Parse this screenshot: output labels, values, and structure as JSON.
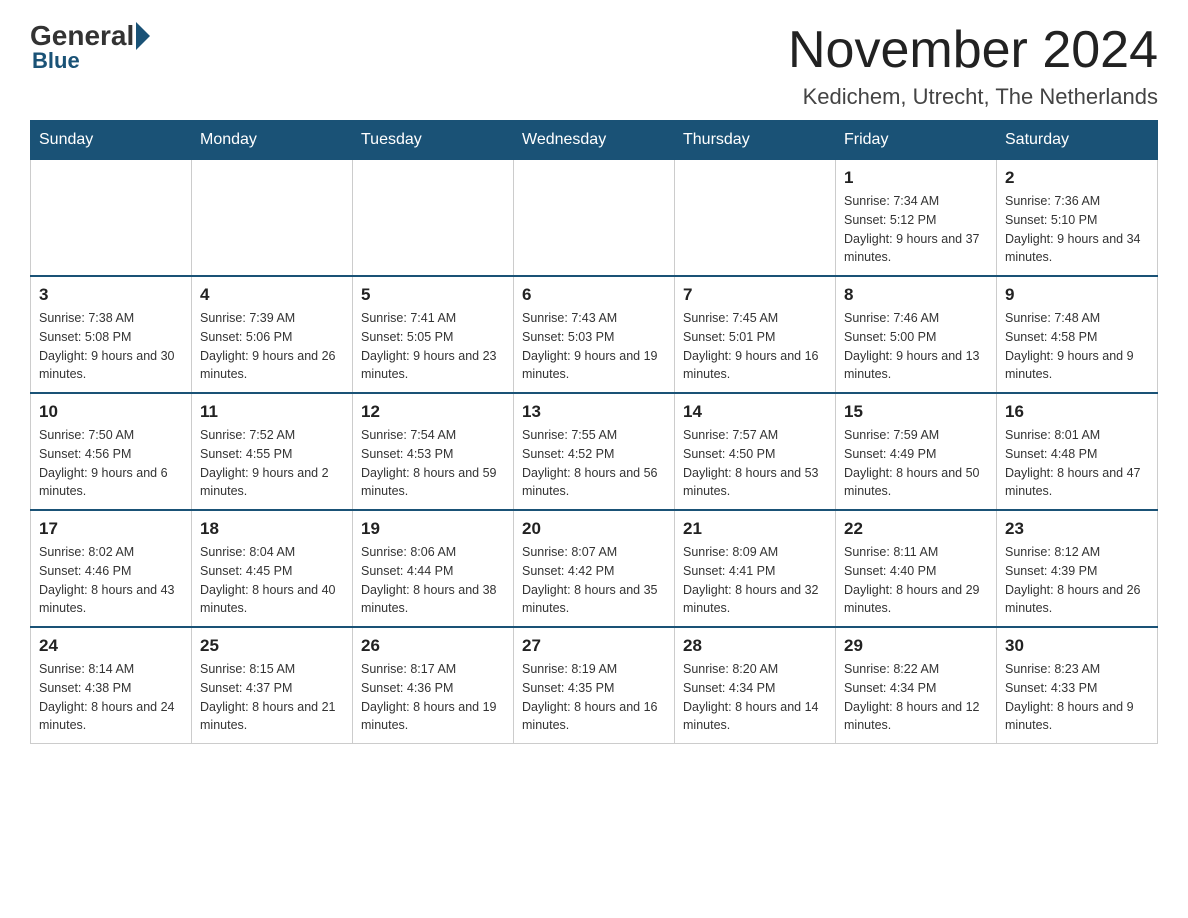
{
  "logo": {
    "general": "General",
    "blue": "Blue"
  },
  "title": "November 2024",
  "location": "Kedichem, Utrecht, The Netherlands",
  "days_of_week": [
    "Sunday",
    "Monday",
    "Tuesday",
    "Wednesday",
    "Thursday",
    "Friday",
    "Saturday"
  ],
  "weeks": [
    [
      {
        "day": "",
        "info": ""
      },
      {
        "day": "",
        "info": ""
      },
      {
        "day": "",
        "info": ""
      },
      {
        "day": "",
        "info": ""
      },
      {
        "day": "",
        "info": ""
      },
      {
        "day": "1",
        "info": "Sunrise: 7:34 AM\nSunset: 5:12 PM\nDaylight: 9 hours and 37 minutes."
      },
      {
        "day": "2",
        "info": "Sunrise: 7:36 AM\nSunset: 5:10 PM\nDaylight: 9 hours and 34 minutes."
      }
    ],
    [
      {
        "day": "3",
        "info": "Sunrise: 7:38 AM\nSunset: 5:08 PM\nDaylight: 9 hours and 30 minutes."
      },
      {
        "day": "4",
        "info": "Sunrise: 7:39 AM\nSunset: 5:06 PM\nDaylight: 9 hours and 26 minutes."
      },
      {
        "day": "5",
        "info": "Sunrise: 7:41 AM\nSunset: 5:05 PM\nDaylight: 9 hours and 23 minutes."
      },
      {
        "day": "6",
        "info": "Sunrise: 7:43 AM\nSunset: 5:03 PM\nDaylight: 9 hours and 19 minutes."
      },
      {
        "day": "7",
        "info": "Sunrise: 7:45 AM\nSunset: 5:01 PM\nDaylight: 9 hours and 16 minutes."
      },
      {
        "day": "8",
        "info": "Sunrise: 7:46 AM\nSunset: 5:00 PM\nDaylight: 9 hours and 13 minutes."
      },
      {
        "day": "9",
        "info": "Sunrise: 7:48 AM\nSunset: 4:58 PM\nDaylight: 9 hours and 9 minutes."
      }
    ],
    [
      {
        "day": "10",
        "info": "Sunrise: 7:50 AM\nSunset: 4:56 PM\nDaylight: 9 hours and 6 minutes."
      },
      {
        "day": "11",
        "info": "Sunrise: 7:52 AM\nSunset: 4:55 PM\nDaylight: 9 hours and 2 minutes."
      },
      {
        "day": "12",
        "info": "Sunrise: 7:54 AM\nSunset: 4:53 PM\nDaylight: 8 hours and 59 minutes."
      },
      {
        "day": "13",
        "info": "Sunrise: 7:55 AM\nSunset: 4:52 PM\nDaylight: 8 hours and 56 minutes."
      },
      {
        "day": "14",
        "info": "Sunrise: 7:57 AM\nSunset: 4:50 PM\nDaylight: 8 hours and 53 minutes."
      },
      {
        "day": "15",
        "info": "Sunrise: 7:59 AM\nSunset: 4:49 PM\nDaylight: 8 hours and 50 minutes."
      },
      {
        "day": "16",
        "info": "Sunrise: 8:01 AM\nSunset: 4:48 PM\nDaylight: 8 hours and 47 minutes."
      }
    ],
    [
      {
        "day": "17",
        "info": "Sunrise: 8:02 AM\nSunset: 4:46 PM\nDaylight: 8 hours and 43 minutes."
      },
      {
        "day": "18",
        "info": "Sunrise: 8:04 AM\nSunset: 4:45 PM\nDaylight: 8 hours and 40 minutes."
      },
      {
        "day": "19",
        "info": "Sunrise: 8:06 AM\nSunset: 4:44 PM\nDaylight: 8 hours and 38 minutes."
      },
      {
        "day": "20",
        "info": "Sunrise: 8:07 AM\nSunset: 4:42 PM\nDaylight: 8 hours and 35 minutes."
      },
      {
        "day": "21",
        "info": "Sunrise: 8:09 AM\nSunset: 4:41 PM\nDaylight: 8 hours and 32 minutes."
      },
      {
        "day": "22",
        "info": "Sunrise: 8:11 AM\nSunset: 4:40 PM\nDaylight: 8 hours and 29 minutes."
      },
      {
        "day": "23",
        "info": "Sunrise: 8:12 AM\nSunset: 4:39 PM\nDaylight: 8 hours and 26 minutes."
      }
    ],
    [
      {
        "day": "24",
        "info": "Sunrise: 8:14 AM\nSunset: 4:38 PM\nDaylight: 8 hours and 24 minutes."
      },
      {
        "day": "25",
        "info": "Sunrise: 8:15 AM\nSunset: 4:37 PM\nDaylight: 8 hours and 21 minutes."
      },
      {
        "day": "26",
        "info": "Sunrise: 8:17 AM\nSunset: 4:36 PM\nDaylight: 8 hours and 19 minutes."
      },
      {
        "day": "27",
        "info": "Sunrise: 8:19 AM\nSunset: 4:35 PM\nDaylight: 8 hours and 16 minutes."
      },
      {
        "day": "28",
        "info": "Sunrise: 8:20 AM\nSunset: 4:34 PM\nDaylight: 8 hours and 14 minutes."
      },
      {
        "day": "29",
        "info": "Sunrise: 8:22 AM\nSunset: 4:34 PM\nDaylight: 8 hours and 12 minutes."
      },
      {
        "day": "30",
        "info": "Sunrise: 8:23 AM\nSunset: 4:33 PM\nDaylight: 8 hours and 9 minutes."
      }
    ]
  ]
}
